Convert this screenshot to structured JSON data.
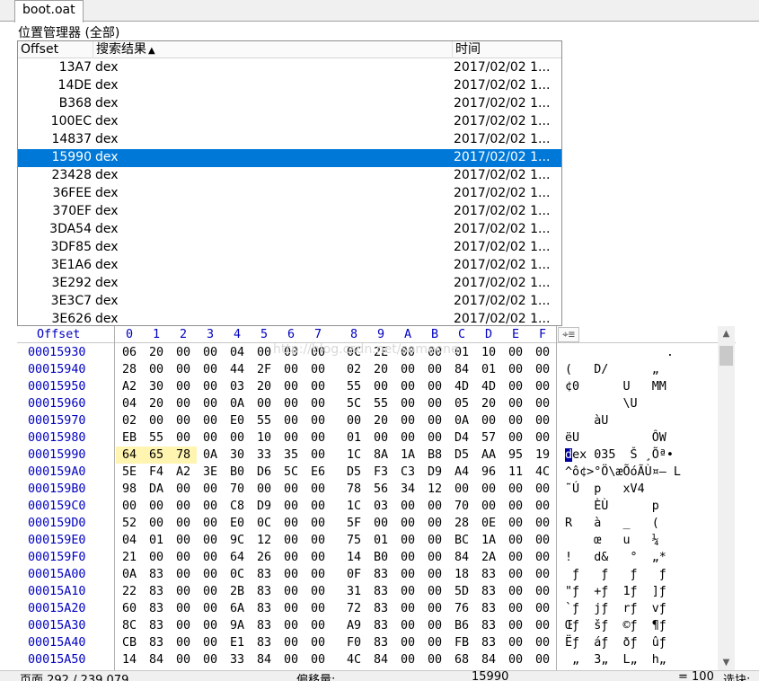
{
  "tab": {
    "label": "boot.oat"
  },
  "location_manager": {
    "title": "位置管理器 (全部)",
    "columns": {
      "offset": "Offset",
      "result": "搜索结果",
      "time": "时间"
    },
    "rows": [
      {
        "offset": "13A7",
        "name": "dex",
        "time": "2017/02/02  1..."
      },
      {
        "offset": "14DE",
        "name": "dex",
        "time": "2017/02/02  1..."
      },
      {
        "offset": "B368",
        "name": "dex",
        "time": "2017/02/02  1..."
      },
      {
        "offset": "100EC",
        "name": "dex",
        "time": "2017/02/02  1..."
      },
      {
        "offset": "14837",
        "name": "dex",
        "time": "2017/02/02  1..."
      },
      {
        "offset": "15990",
        "name": "dex",
        "time": "2017/02/02  1...",
        "selected": true
      },
      {
        "offset": "23428",
        "name": "dex",
        "time": "2017/02/02  1..."
      },
      {
        "offset": "36FEE",
        "name": "dex",
        "time": "2017/02/02  1..."
      },
      {
        "offset": "370EF",
        "name": "dex",
        "time": "2017/02/02  1..."
      },
      {
        "offset": "3DA54",
        "name": "dex",
        "time": "2017/02/02  1..."
      },
      {
        "offset": "3DF85",
        "name": "dex",
        "time": "2017/02/02  1..."
      },
      {
        "offset": "3E1A6",
        "name": "dex",
        "time": "2017/02/02  1..."
      },
      {
        "offset": "3E292",
        "name": "dex",
        "time": "2017/02/02  1..."
      },
      {
        "offset": "3E3C7",
        "name": "dex",
        "time": "2017/02/02  1..."
      },
      {
        "offset": "3E626",
        "name": "dex",
        "time": "2017/02/02  1..."
      }
    ]
  },
  "hex_editor": {
    "offset_header": "Offset",
    "column_headers": [
      "0",
      "1",
      "2",
      "3",
      "4",
      "5",
      "6",
      "7",
      "8",
      "9",
      "A",
      "B",
      "C",
      "D",
      "E",
      "F"
    ],
    "watermark": "http://blog.csdn.net/someone",
    "rows": [
      {
        "offset": "00015930",
        "bytes": [
          "06",
          "20",
          "00",
          "00",
          "04",
          "00",
          "00",
          "00",
          "0C",
          "2E",
          "00",
          "00",
          "01",
          "10",
          "00",
          "00"
        ],
        "ascii": "              ."
      },
      {
        "offset": "00015940",
        "bytes": [
          "28",
          "00",
          "00",
          "00",
          "44",
          "2F",
          "00",
          "00",
          "02",
          "20",
          "00",
          "00",
          "84",
          "01",
          "00",
          "00"
        ],
        "ascii": "(   D/      „"
      },
      {
        "offset": "00015950",
        "bytes": [
          "A2",
          "30",
          "00",
          "00",
          "03",
          "20",
          "00",
          "00",
          "55",
          "00",
          "00",
          "00",
          "4D",
          "4D",
          "00",
          "00"
        ],
        "ascii": "¢0      U   MM"
      },
      {
        "offset": "00015960",
        "bytes": [
          "04",
          "20",
          "00",
          "00",
          "0A",
          "00",
          "00",
          "00",
          "5C",
          "55",
          "00",
          "00",
          "05",
          "20",
          "00",
          "00"
        ],
        "ascii": "        \\U"
      },
      {
        "offset": "00015970",
        "bytes": [
          "02",
          "00",
          "00",
          "00",
          "E0",
          "55",
          "00",
          "00",
          "00",
          "20",
          "00",
          "00",
          "0A",
          "00",
          "00",
          "00"
        ],
        "ascii": "    àU"
      },
      {
        "offset": "00015980",
        "bytes": [
          "EB",
          "55",
          "00",
          "00",
          "00",
          "10",
          "00",
          "00",
          "01",
          "00",
          "00",
          "00",
          "D4",
          "57",
          "00",
          "00"
        ],
        "ascii": "ëU          ÔW"
      },
      {
        "offset": "00015990",
        "bytes": [
          "64",
          "65",
          "78",
          "0A",
          "30",
          "33",
          "35",
          "00",
          "1C",
          "8A",
          "1A",
          "B8",
          "D5",
          "AA",
          "95",
          "19"
        ],
        "ascii_cursor": "d",
        "ascii": "ex 035  Š ¸Õª•",
        "highlight": [
          0,
          1,
          2
        ]
      },
      {
        "offset": "000159A0",
        "bytes": [
          "5E",
          "F4",
          "A2",
          "3E",
          "B0",
          "D6",
          "5C",
          "E6",
          "D5",
          "F3",
          "C3",
          "D9",
          "A4",
          "96",
          "11",
          "4C"
        ],
        "ascii": "^ô¢>°Ö\\æÕóÃÙ¤– L"
      },
      {
        "offset": "000159B0",
        "bytes": [
          "98",
          "DA",
          "00",
          "00",
          "70",
          "00",
          "00",
          "00",
          "78",
          "56",
          "34",
          "12",
          "00",
          "00",
          "00",
          "00"
        ],
        "ascii": "˜Ú  p   xV4"
      },
      {
        "offset": "000159C0",
        "bytes": [
          "00",
          "00",
          "00",
          "00",
          "C8",
          "D9",
          "00",
          "00",
          "1C",
          "03",
          "00",
          "00",
          "70",
          "00",
          "00",
          "00"
        ],
        "ascii": "    ÈÙ      p"
      },
      {
        "offset": "000159D0",
        "bytes": [
          "52",
          "00",
          "00",
          "00",
          "E0",
          "0C",
          "00",
          "00",
          "5F",
          "00",
          "00",
          "00",
          "28",
          "0E",
          "00",
          "00"
        ],
        "ascii": "R   à   _   ("
      },
      {
        "offset": "000159E0",
        "bytes": [
          "04",
          "01",
          "00",
          "00",
          "9C",
          "12",
          "00",
          "00",
          "75",
          "01",
          "00",
          "00",
          "BC",
          "1A",
          "00",
          "00"
        ],
        "ascii": "    œ   u   ¼"
      },
      {
        "offset": "000159F0",
        "bytes": [
          "21",
          "00",
          "00",
          "00",
          "64",
          "26",
          "00",
          "00",
          "14",
          "B0",
          "00",
          "00",
          "84",
          "2A",
          "00",
          "00"
        ],
        "ascii": "!   d&   °  „*"
      },
      {
        "offset": "00015A00",
        "bytes": [
          "0A",
          "83",
          "00",
          "00",
          "0C",
          "83",
          "00",
          "00",
          "0F",
          "83",
          "00",
          "00",
          "18",
          "83",
          "00",
          "00"
        ],
        "ascii": " ƒ   ƒ   ƒ   ƒ"
      },
      {
        "offset": "00015A10",
        "bytes": [
          "22",
          "83",
          "00",
          "00",
          "2B",
          "83",
          "00",
          "00",
          "31",
          "83",
          "00",
          "00",
          "5D",
          "83",
          "00",
          "00"
        ],
        "ascii": "\"ƒ  +ƒ  1ƒ  ]ƒ"
      },
      {
        "offset": "00015A20",
        "bytes": [
          "60",
          "83",
          "00",
          "00",
          "6A",
          "83",
          "00",
          "00",
          "72",
          "83",
          "00",
          "00",
          "76",
          "83",
          "00",
          "00"
        ],
        "ascii": "`ƒ  jƒ  rƒ  vƒ"
      },
      {
        "offset": "00015A30",
        "bytes": [
          "8C",
          "83",
          "00",
          "00",
          "9A",
          "83",
          "00",
          "00",
          "A9",
          "83",
          "00",
          "00",
          "B6",
          "83",
          "00",
          "00"
        ],
        "ascii": "Œƒ  šƒ  ©ƒ  ¶ƒ"
      },
      {
        "offset": "00015A40",
        "bytes": [
          "CB",
          "83",
          "00",
          "00",
          "E1",
          "83",
          "00",
          "00",
          "F0",
          "83",
          "00",
          "00",
          "FB",
          "83",
          "00",
          "00"
        ],
        "ascii": "Ëƒ  áƒ  ðƒ  ûƒ"
      },
      {
        "offset": "00015A50",
        "bytes": [
          "14",
          "84",
          "00",
          "00",
          "33",
          "84",
          "00",
          "00",
          "4C",
          "84",
          "00",
          "00",
          "68",
          "84",
          "00",
          "00"
        ],
        "ascii": " „  3„  L„  h„"
      }
    ]
  },
  "status_bar": {
    "page": "页面 292 / 239,079",
    "offset_label": "偏移量:",
    "offset_value": "15990",
    "value": "= 100",
    "select_label": "选块:"
  },
  "icons": {
    "sort": "sort-ascending-icon",
    "column_picker": "crosshair-icon",
    "scroll_up": "chevron-up-icon",
    "scroll_down": "chevron-down-icon"
  },
  "colors": {
    "selection": "#0078d7",
    "offset_blue": "#0000c0",
    "highlight": "#fff4b0",
    "cursor": "#0000a0"
  }
}
